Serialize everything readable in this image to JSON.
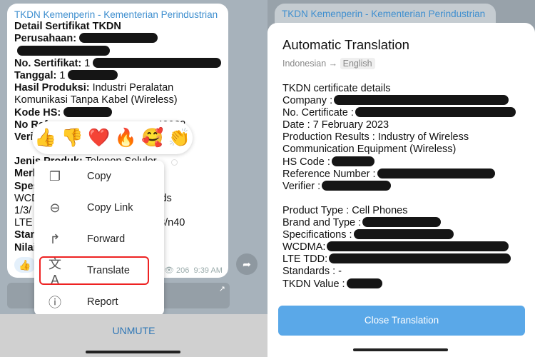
{
  "message": {
    "source": "TKDN Kemenperin - Kementerian Perindustrian",
    "lines": [
      {
        "b": "Detail Sertifikat TKDN",
        "t": ""
      },
      {
        "b": "Perusahaan:",
        "t": ""
      },
      {
        "b": "",
        "t": ""
      },
      {
        "b": "No. Sertifikat:",
        "t": " 1"
      },
      {
        "b": "Tanggal:",
        "t": " 1"
      },
      {
        "b": "Hasil Produksi:",
        "t": " Industri Peralatan"
      },
      {
        "b": "",
        "t": "Komunikasi Tanpa Kabel (Wireless)"
      },
      {
        "b": "Kode HS:",
        "t": ""
      },
      {
        "b": "No Ref",
        "t": "                                      40062"
      },
      {
        "b": "Veri",
        "t": ""
      },
      {
        "b": "",
        "t": ""
      },
      {
        "b": "Jenis Produk:",
        "t": " Telepon Seluler"
      },
      {
        "b": "Merk",
        "t": ""
      },
      {
        "b": "Spes",
        "t": ""
      },
      {
        "b": "",
        "t": "WCD                                   :Bands"
      },
      {
        "b": "",
        "t": "1/3/"
      },
      {
        "b": "",
        "t": "LTE T                                 /n5/n8/n40"
      },
      {
        "b": "Stan",
        "t": ""
      },
      {
        "b": "Nilai",
        "t": ""
      }
    ],
    "reaction": "👍",
    "views": "206",
    "time": "9:39 AM"
  },
  "reactions": [
    "👍",
    "👎",
    "❤️",
    "🔥",
    "🥰",
    "👏"
  ],
  "menu": [
    {
      "icon": "copy-icon",
      "g": "❐",
      "label": "Copy"
    },
    {
      "icon": "link-icon",
      "g": "⊖",
      "label": "Copy Link"
    },
    {
      "icon": "forward-icon",
      "g": "↱",
      "label": "Forward"
    },
    {
      "icon": "translate-icon",
      "g": "文A",
      "label": "Translate",
      "highlight": true
    },
    {
      "icon": "report-icon",
      "g": "ⓘ",
      "label": "Report"
    }
  ],
  "bottom": {
    "unmute": "UNMUTE"
  },
  "translation": {
    "title": "Automatic Translation",
    "from": "Indonesian",
    "arrow": "→",
    "to": "English",
    "lines": [
      "TKDN certificate details",
      "Company :",
      "No. Certificate :",
      "Date : 7 February 2023",
      "Production Results : Industry of Wireless",
      "Communication Equipment (Wireless)",
      "HS Code :",
      "Reference Number :",
      "Verifier :",
      "",
      "Product Type : Cell Phones",
      "Brand and Type :",
      "Specifications :",
      "WCDMA:",
      "LTE TDD:",
      "Standards : -",
      "TKDN Value :"
    ],
    "close": "Close Translation"
  },
  "colors": {
    "accent": "#3f8fcf",
    "highlight": "#e22222",
    "button": "#5aa8e8"
  }
}
